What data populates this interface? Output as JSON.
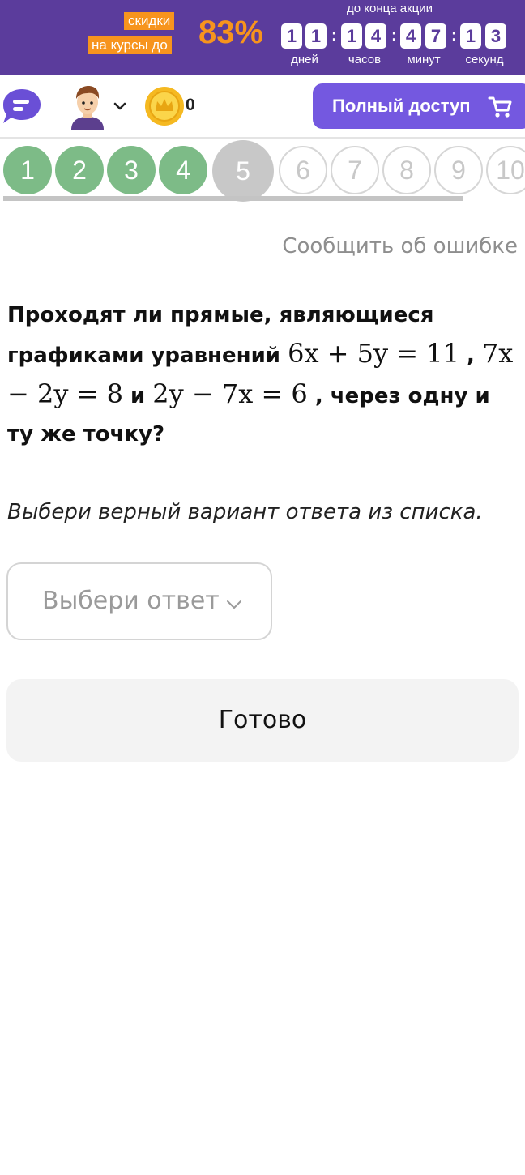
{
  "promo": {
    "tag_line1": "скидки",
    "tag_line2": "на курсы до",
    "percent": "83%",
    "caption": "до конца акции",
    "timer": {
      "days": [
        "1",
        "1"
      ],
      "hours": [
        "1",
        "4"
      ],
      "minutes": [
        "4",
        "7"
      ],
      "seconds": [
        "1",
        "3"
      ],
      "separator": ":",
      "labels": {
        "days": "дней",
        "hours": "часов",
        "minutes": "минут",
        "seconds": "секунд"
      }
    },
    "colors": {
      "background": "#5b3c9c",
      "accent": "#f7941d"
    }
  },
  "header": {
    "chat_icon": "chat-bubble-icon",
    "avatar_icon": "boy-avatar-icon",
    "coins": "0",
    "full_access_label": "Полный доступ",
    "cart_icon": "cart-icon",
    "colors": {
      "button": "#7458e0",
      "chat": "#6a4fd6",
      "coin": "#f5b921"
    }
  },
  "progress": {
    "steps": [
      "1",
      "2",
      "3",
      "4",
      "5",
      "6",
      "7",
      "8",
      "9",
      "10"
    ],
    "completed": 4,
    "current": "5",
    "colors": {
      "done": "#7dbb87",
      "current": "#c8c8c8"
    }
  },
  "report_error_label": "Сообщить об ошибке",
  "question": {
    "text1": "Проходят ли прямые, являющиеся графиками уравнений ",
    "eq1": "6x + 5y = 11",
    "text2": " , ",
    "eq2": "7x − 2y = 8",
    "text3": " и ",
    "eq3": "2y − 7x = 6",
    "text4": " , через одну и ту же точку?"
  },
  "instruction": "Выбери верный вариант ответа из списка.",
  "answer_select": {
    "placeholder": "Выбери ответ"
  },
  "submit_label": "Готово"
}
